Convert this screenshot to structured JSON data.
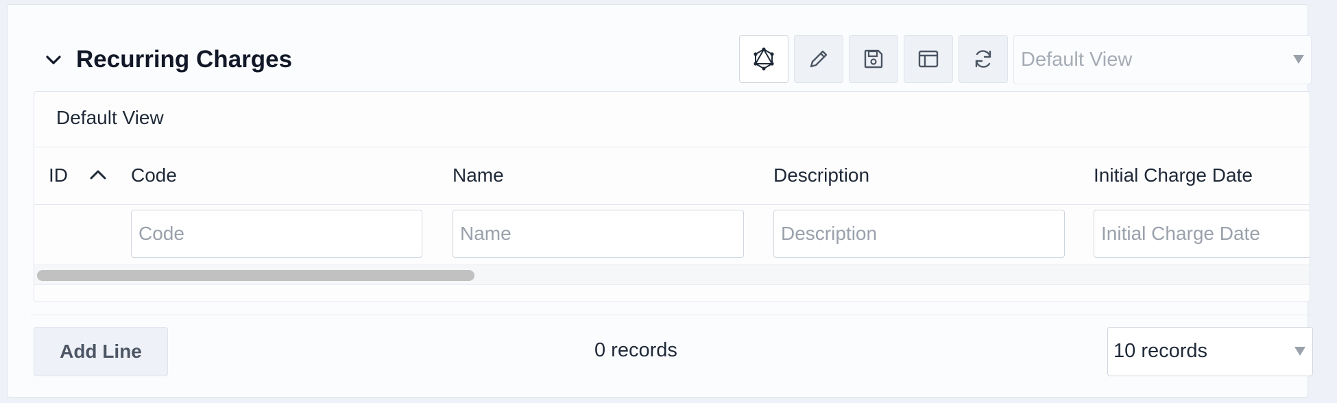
{
  "section": {
    "title": "Recurring Charges"
  },
  "toolbar": {
    "buttons": [
      {
        "icon": "graphql-icon"
      },
      {
        "icon": "pencil-icon"
      },
      {
        "icon": "save-icon"
      },
      {
        "icon": "layout-icon"
      },
      {
        "icon": "refresh-icon"
      }
    ],
    "view_select": "Default View"
  },
  "grid": {
    "view_title": "Default View",
    "columns": [
      "ID",
      "Code",
      "Name",
      "Description",
      "Initial Charge Date"
    ],
    "sort": {
      "column": "ID",
      "direction": "ascending"
    },
    "filters": {
      "code_placeholder": "Code",
      "name_placeholder": "Name",
      "description_placeholder": "Description",
      "initial_charge_date_placeholder": "Initial Charge Date"
    }
  },
  "footer": {
    "add_line_label": "Add Line",
    "record_count": "0 records",
    "page_size": "10 records"
  },
  "colors": {
    "panel_bg": "#fbfcfe",
    "button_bg": "#eef1f7",
    "border": "#dfe4ec"
  }
}
